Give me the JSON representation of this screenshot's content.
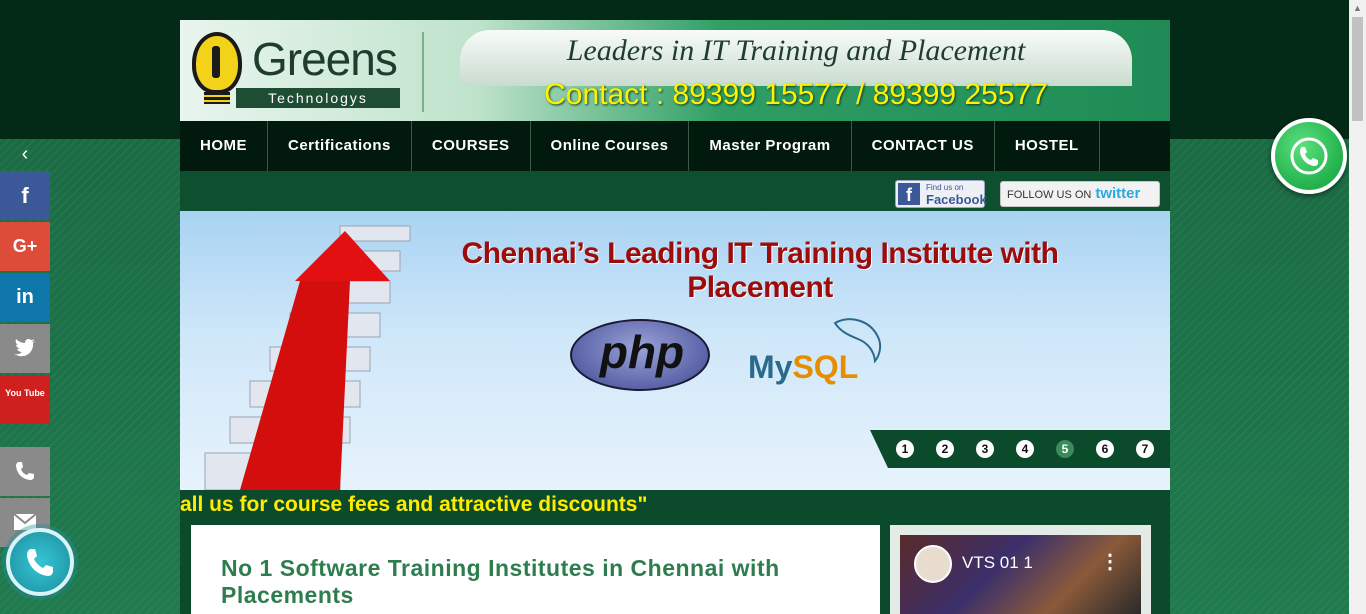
{
  "header": {
    "logo_name": "Greens",
    "logo_sub": "Technologys",
    "tagline": "Leaders in IT Training and Placement",
    "contact": "Contact : 89399 15577 / 89399 25577"
  },
  "nav": {
    "items": [
      "HOME",
      "Certifications",
      "COURSES",
      "Online Courses",
      "Master Program",
      "CONTACT US",
      "HOSTEL"
    ]
  },
  "social": {
    "fb_small": "Find us on",
    "fb_big": "Facebook",
    "tw_prefix": "FOLLOW US ON",
    "tw_brand": "twitter"
  },
  "banner": {
    "title": "Chennai’s Leading IT Training Institute with Placement",
    "php_label": "php",
    "mysql_my": "My",
    "mysql_sql": "SQL",
    "slides": [
      "1",
      "2",
      "3",
      "4",
      "5",
      "6",
      "7"
    ],
    "active_slide": "5"
  },
  "marquee": "all us for course fees and attractive discounts\"",
  "content": {
    "heading": "No 1 Software Training Institutes in Chennai with Placements"
  },
  "video": {
    "title": "VTS 01 1",
    "menu": "⋮"
  },
  "left_rail": {
    "collapse": "‹",
    "facebook": "f",
    "googleplus": "G+",
    "linkedin": "in",
    "twitter": "t",
    "youtube": "You Tube"
  },
  "colors": {
    "nav_bg": "#021a0d",
    "accent_green": "#2e7d4f",
    "marquee_yellow": "#ffec00",
    "banner_red": "#9e0b0b",
    "contact_yellow": "#fff200"
  }
}
